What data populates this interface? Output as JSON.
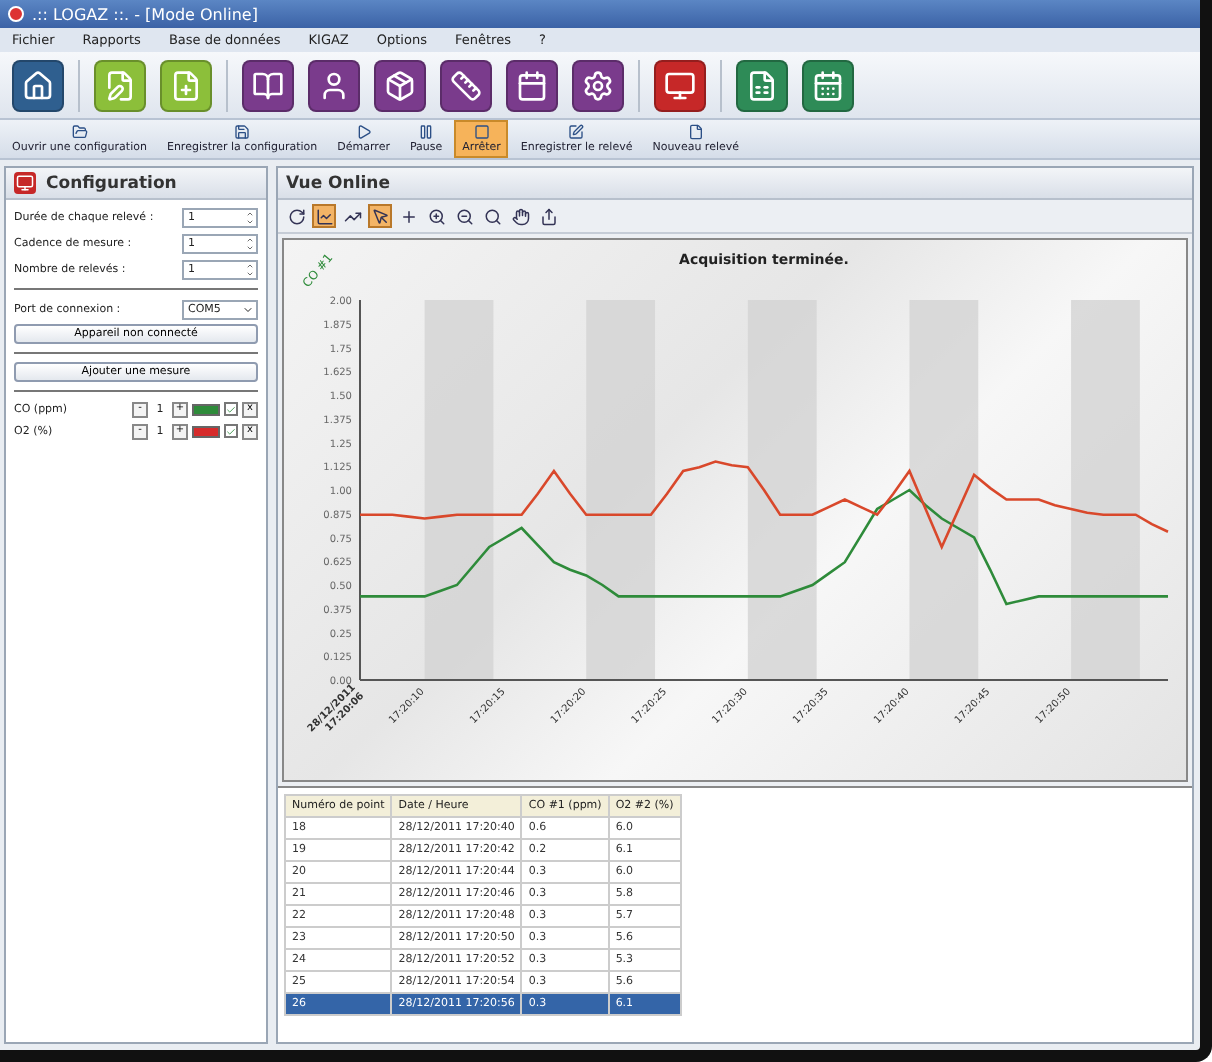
{
  "window": {
    "title": ".:: LOGAZ ::. - [Mode Online]"
  },
  "menu": [
    "Fichier",
    "Rapports",
    "Base de données",
    "KIGAZ",
    "Options",
    "Fenêtres",
    "?"
  ],
  "actions": [
    {
      "kind": "open",
      "label": "Ouvrir une configuration",
      "selected": false
    },
    {
      "kind": "save",
      "label": "Enregistrer la configuration",
      "selected": false
    },
    {
      "kind": "start",
      "label": "Démarrer",
      "selected": false
    },
    {
      "kind": "pause",
      "label": "Pause",
      "selected": false
    },
    {
      "kind": "stop",
      "label": "Arrêter",
      "selected": true
    },
    {
      "kind": "record",
      "label": "Enregistrer le relevé",
      "selected": false
    },
    {
      "kind": "new",
      "label": "Nouveau relevé",
      "selected": false
    }
  ],
  "config": {
    "title": "Configuration",
    "fields": [
      {
        "label": "Durée de chaque relevé :",
        "value": "1"
      },
      {
        "label": "Cadence de mesure :",
        "value": "1"
      },
      {
        "label": "Nombre de relevés :",
        "value": "1"
      }
    ],
    "port": {
      "label": "Port de connexion :",
      "value": "COM5"
    },
    "connect_button": "Appareil non connecté",
    "add_button": "Ajouter une mesure",
    "measures": [
      {
        "name": "CO (ppm)",
        "value": "1",
        "minus": "-",
        "plus": "+",
        "remove": "x",
        "color": "#2e8b3a",
        "checked": true
      },
      {
        "name": "O2 (%)",
        "value": "1",
        "minus": "-",
        "plus": "+",
        "remove": "x",
        "color": "#d62b2b",
        "checked": true
      }
    ]
  },
  "view": {
    "title": "Vue Online",
    "tools": [
      {
        "kind": "refresh",
        "selected": false
      },
      {
        "kind": "lines",
        "selected": true
      },
      {
        "kind": "points",
        "selected": false
      },
      {
        "kind": "pointer",
        "selected": true
      },
      {
        "kind": "cross",
        "selected": false
      },
      {
        "kind": "zoom",
        "selected": false
      },
      {
        "kind": "zoom-out",
        "selected": false
      },
      {
        "kind": "zoom-fit",
        "selected": false
      },
      {
        "kind": "pan",
        "selected": false
      },
      {
        "kind": "export",
        "selected": false
      }
    ],
    "chart_data": {
      "type": "line",
      "title": "Acquisition terminée.",
      "ylabel": "CO #1",
      "categories": [
        "28/12/2011 17:20:06",
        null,
        null,
        null,
        "17:20:10",
        null,
        null,
        null,
        null,
        "17:20:15",
        null,
        null,
        null,
        null,
        "17:20:20",
        null,
        null,
        null,
        null,
        "17:20:25",
        null,
        null,
        null,
        null,
        "17:20:30",
        null,
        null,
        null,
        null,
        "17:20:35",
        null,
        null,
        null,
        null,
        "17:20:40",
        null,
        null,
        null,
        null,
        "17:20:45",
        null,
        null,
        null,
        null,
        "17:20:50",
        null,
        null,
        null,
        null,
        null,
        null
      ],
      "ylim": [
        0,
        2
      ],
      "yticks": [
        {
          "value": 0,
          "label": "0.00"
        },
        0.125,
        0.25,
        0.375,
        {
          "value": 0.5,
          "label": "0.50"
        },
        0.625,
        0.75,
        0.875,
        {
          "value": 1,
          "label": "1.00"
        },
        1.125,
        1.25,
        1.375,
        {
          "value": 1.5,
          "label": "1.50"
        },
        1.625,
        1.75,
        1.875,
        {
          "value": 2,
          "label": "2.00"
        }
      ],
      "series": [
        {
          "color": "#2e8b3a",
          "values": [
            0.44,
            0.44,
            0.44,
            0.44,
            0.44,
            0.47,
            0.5,
            0.6,
            0.7,
            0.75,
            0.8,
            0.71,
            0.62,
            0.58,
            0.55,
            0.5,
            0.44,
            0.44,
            0.44,
            0.44,
            0.44,
            0.44,
            0.44,
            0.44,
            0.44,
            0.44,
            0.44,
            0.47,
            0.5,
            0.56,
            0.62,
            0.76,
            0.9,
            0.95,
            1.0,
            0.92,
            0.85,
            0.8,
            0.75,
            0.58,
            0.4,
            0.42,
            0.44,
            0.44,
            0.44,
            0.44,
            0.44,
            0.44,
            0.44,
            0.44,
            0.44
          ]
        },
        {
          "color": "#d9482b",
          "values": [
            0.87,
            0.87,
            0.87,
            0.86,
            0.85,
            0.86,
            0.87,
            0.87,
            0.87,
            0.87,
            0.87,
            0.98,
            1.1,
            0.98,
            0.87,
            0.87,
            0.87,
            0.87,
            0.87,
            0.98,
            1.1,
            1.12,
            1.15,
            1.13,
            1.12,
            1.0,
            0.87,
            0.87,
            0.87,
            0.91,
            0.95,
            0.91,
            0.87,
            0.98,
            1.1,
            0.9,
            0.7,
            0.89,
            1.08,
            1.01,
            0.95,
            0.95,
            0.95,
            0.92,
            0.9,
            0.88,
            0.87,
            0.87,
            0.87,
            0.82,
            0.78
          ]
        }
      ]
    }
  },
  "table": {
    "columns": [
      "Numéro de point",
      "Date / Heure",
      "CO #1 (ppm)",
      "O2 #2 (%)"
    ],
    "rows": [
      {
        "cells": [
          "18",
          "28/12/2011 17:20:40",
          "0.6",
          "6.0"
        ],
        "selected": false
      },
      {
        "cells": [
          "19",
          "28/12/2011 17:20:42",
          "0.2",
          "6.1"
        ],
        "selected": false
      },
      {
        "cells": [
          "20",
          "28/12/2011 17:20:44",
          "0.3",
          "6.0"
        ],
        "selected": false
      },
      {
        "cells": [
          "21",
          "28/12/2011 17:20:46",
          "0.3",
          "5.8"
        ],
        "selected": false
      },
      {
        "cells": [
          "22",
          "28/12/2011 17:20:48",
          "0.3",
          "5.7"
        ],
        "selected": false
      },
      {
        "cells": [
          "23",
          "28/12/2011 17:20:50",
          "0.3",
          "5.6"
        ],
        "selected": false
      },
      {
        "cells": [
          "24",
          "28/12/2011 17:20:52",
          "0.3",
          "5.3"
        ],
        "selected": false
      },
      {
        "cells": [
          "25",
          "28/12/2011 17:20:54",
          "0.3",
          "5.6"
        ],
        "selected": false
      },
      {
        "cells": [
          "26",
          "28/12/2011 17:20:56",
          "0.3",
          "6.1"
        ],
        "selected": true
      }
    ]
  }
}
